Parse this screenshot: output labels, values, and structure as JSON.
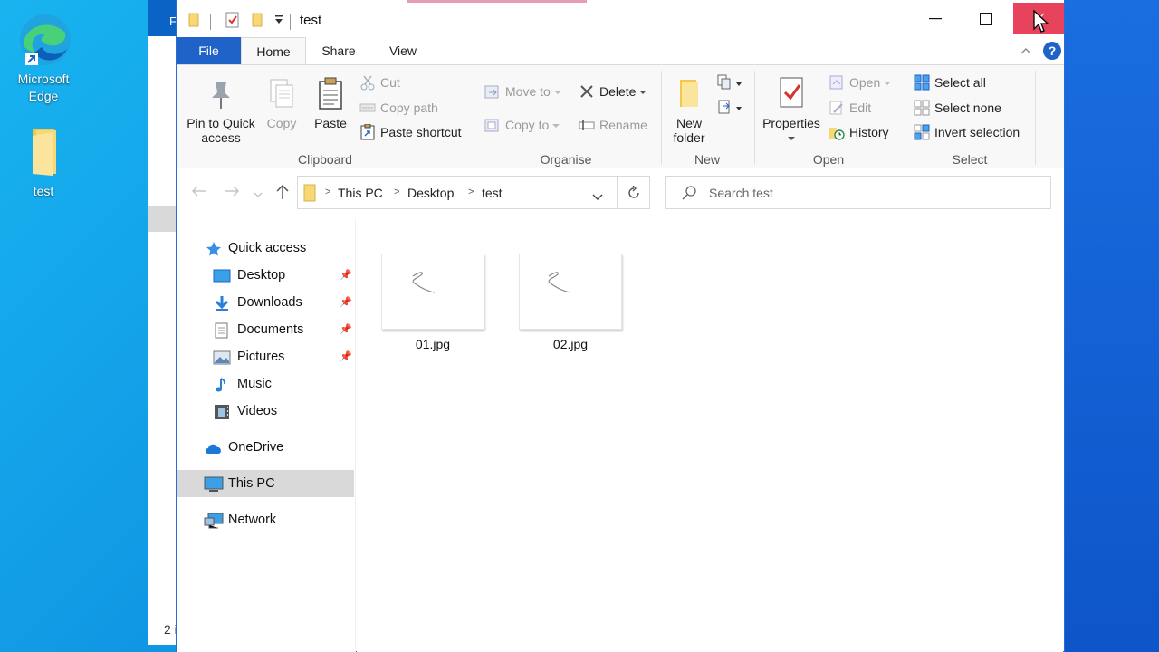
{
  "desktop": {
    "icons": [
      {
        "label_line1": "Microsoft",
        "label_line2": "Edge"
      },
      {
        "label_line1": "test",
        "label_line2": ""
      }
    ],
    "bg_window": {
      "tab_letter": "F",
      "status_text": "2 i"
    }
  },
  "window": {
    "title": "test",
    "tabs": {
      "file": "File",
      "home": "Home",
      "share": "Share",
      "view": "View"
    },
    "ribbon": {
      "clipboard": {
        "label": "Clipboard",
        "pin_line1": "Pin to Quick",
        "pin_line2": "access",
        "copy": "Copy",
        "paste": "Paste",
        "cut": "Cut",
        "copy_path": "Copy path",
        "paste_shortcut": "Paste shortcut"
      },
      "organise": {
        "label": "Organise",
        "move_to": "Move to",
        "copy_to": "Copy to",
        "delete": "Delete",
        "rename": "Rename"
      },
      "new": {
        "label": "New",
        "new_folder_line1": "New",
        "new_folder_line2": "folder"
      },
      "open": {
        "label": "Open",
        "properties": "Properties",
        "open": "Open",
        "edit": "Edit",
        "history": "History"
      },
      "select": {
        "label": "Select",
        "select_all": "Select all",
        "select_none": "Select none",
        "invert_selection": "Invert selection"
      }
    },
    "address": {
      "segments": [
        "This PC",
        "Desktop",
        "test"
      ]
    },
    "search": {
      "placeholder": "Search test"
    },
    "nav": {
      "quick_access": "Quick access",
      "items": [
        "Desktop",
        "Downloads",
        "Documents",
        "Pictures",
        "Music",
        "Videos"
      ],
      "onedrive": "OneDrive",
      "this_pc": "This PC",
      "network": "Network"
    },
    "files": [
      {
        "name": "01.jpg"
      },
      {
        "name": "02.jpg"
      }
    ]
  },
  "colors": {
    "accent": "#1f62c8",
    "close_hover": "#e8435c",
    "folder": "#f8d775"
  }
}
